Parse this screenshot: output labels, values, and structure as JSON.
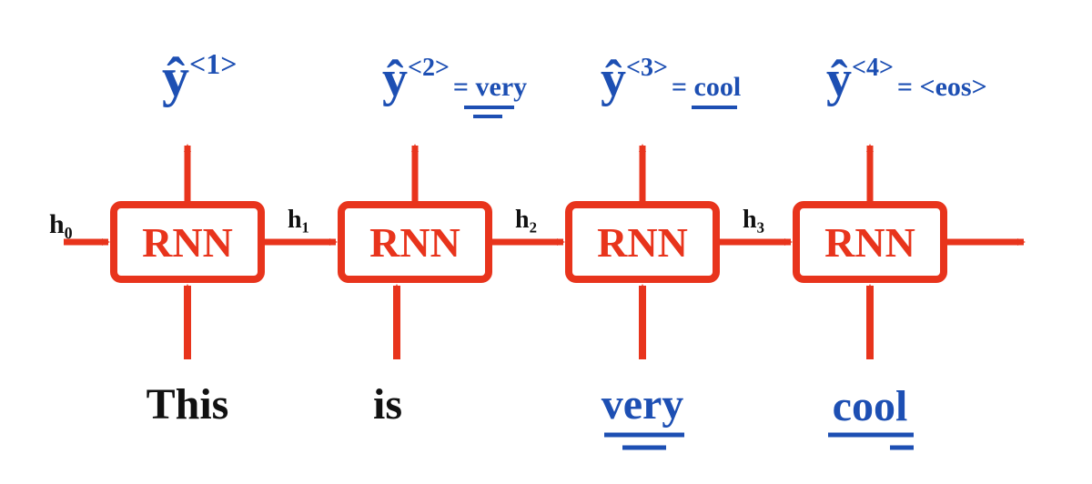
{
  "cell_label": "RNN",
  "hidden": {
    "h0": "h₀",
    "h1": "h₁",
    "h2": "h₂",
    "h3": "h₃"
  },
  "outputs": {
    "y1": {
      "symbol": "ŷ",
      "sup": "<1>",
      "value": ""
    },
    "y2": {
      "symbol": "ŷ",
      "sup": "<2>",
      "value": "= very"
    },
    "y3": {
      "symbol": "ŷ",
      "sup": "<3>",
      "value": "= cool"
    },
    "y4": {
      "symbol": "ŷ",
      "sup": "<4>",
      "value": "= <eos>"
    }
  },
  "inputs": {
    "x1": {
      "text": "This",
      "color": "black"
    },
    "x2": {
      "text": "is",
      "color": "black"
    },
    "x3": {
      "text": "very",
      "color": "blue"
    },
    "x4": {
      "text": "cool",
      "color": "blue"
    }
  },
  "colors": {
    "red": "#E8341C",
    "blue": "#1D4FB3",
    "black": "#111111"
  }
}
